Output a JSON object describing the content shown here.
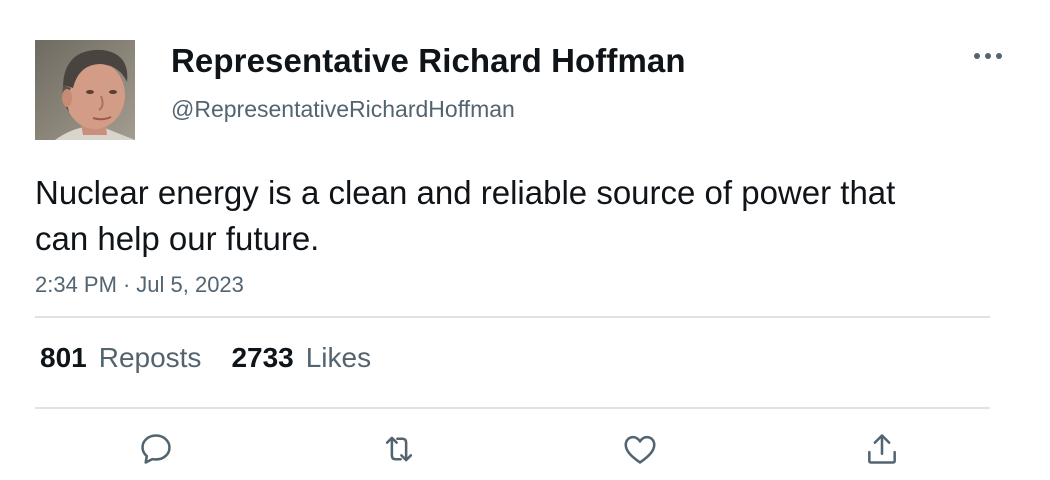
{
  "author": {
    "display_name": "Representative Richard Hoffman",
    "handle": "@RepresentativeRichardHoffman"
  },
  "tweet": {
    "text": "Nuclear energy is a clean and reliable source of power that can help our future.",
    "time": "2:34 PM",
    "separator": "·",
    "date": "Jul 5, 2023"
  },
  "stats": {
    "reposts_count": "801",
    "reposts_label": "Reposts",
    "likes_count": "2733",
    "likes_label": "Likes"
  },
  "icons": {
    "more": "more-horizontal-icon",
    "reply": "reply-icon",
    "repost": "repost-icon",
    "like": "heart-icon",
    "share": "share-icon"
  },
  "colors": {
    "text_primary": "#0f1419",
    "text_secondary": "#536471",
    "divider": "#dfe3e7"
  }
}
